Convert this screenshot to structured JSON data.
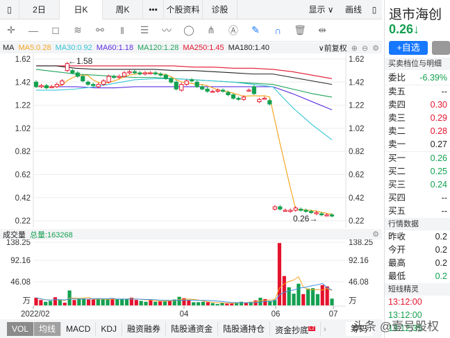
{
  "tabs": [
    "2日",
    "日K",
    "周K",
    "•••",
    "个股资料",
    "诊股"
  ],
  "tab_display": "显示 ∨",
  "tab_draw": "画线",
  "stock": {
    "name": "退市海创",
    "price": "0.26",
    "arrow": "↓",
    "add_btn": "+自选"
  },
  "ma_legend": {
    "ma": "MA",
    "ma5": "MA5:0.28",
    "ma30": "MA30:0.92",
    "ma60": "MA60:1.18",
    "ma120": "MA120:1.28",
    "ma250": "MA250:1.45",
    "ma180": "MA180:1.40",
    "adjust": "∨前复权"
  },
  "colors": {
    "up": "#e5132d",
    "down": "#14a050",
    "ma5": "#f5a623",
    "ma30": "#36c5d6",
    "ma60": "#5b2ee0",
    "ma120": "#1fa35a",
    "ma250": "#e5132d",
    "ma180": "#222222"
  },
  "price_axis": [
    "1.62",
    "1.42",
    "1.22",
    "1.02",
    "0.82",
    "0.62",
    "0.42",
    "0.22"
  ],
  "annot_high": "←1.58",
  "annot_low": "0.26→",
  "volume": {
    "title": "成交量",
    "total": "总量:163268",
    "axis": [
      "138.25",
      "92.16",
      "46.08",
      "万"
    ]
  },
  "dates": [
    "2022/02",
    "04",
    "06",
    "07"
  ],
  "bottom_tabs": [
    "VOL",
    "均线",
    "MACD",
    "KDJ",
    "融资融券",
    "陆股通资金",
    "陆股通持仓",
    "资金抄底"
  ],
  "bottom_badge": "L2",
  "chips": "筹码",
  "chart_data": {
    "type": "candlestick",
    "ylim": [
      0.22,
      1.62
    ],
    "candles": [
      [
        1.42,
        1.38
      ],
      [
        1.38,
        1.39
      ],
      [
        1.39,
        1.37
      ],
      [
        1.38,
        1.38
      ],
      [
        1.38,
        1.4
      ],
      [
        1.4,
        1.43
      ],
      [
        1.52,
        1.58
      ],
      [
        1.52,
        1.5
      ],
      [
        1.5,
        1.47
      ],
      [
        1.47,
        1.43
      ],
      [
        1.42,
        1.4
      ],
      [
        1.4,
        1.39
      ],
      [
        1.38,
        1.4
      ],
      [
        1.4,
        1.43
      ],
      [
        1.42,
        1.47
      ],
      [
        1.47,
        1.46
      ],
      [
        1.46,
        1.47
      ],
      [
        1.47,
        1.5
      ],
      [
        1.5,
        1.51
      ],
      [
        1.51,
        1.5
      ],
      [
        1.5,
        1.49
      ],
      [
        1.49,
        1.5
      ],
      [
        1.5,
        1.5
      ],
      [
        1.5,
        1.49
      ],
      [
        1.49,
        1.48
      ],
      [
        1.48,
        1.45
      ],
      [
        1.45,
        1.42
      ],
      [
        1.42,
        1.36
      ],
      [
        1.35,
        1.4
      ],
      [
        1.4,
        1.43
      ],
      [
        1.44,
        1.43
      ],
      [
        1.42,
        1.38
      ],
      [
        1.38,
        1.36
      ],
      [
        1.36,
        1.34
      ],
      [
        1.34,
        1.34
      ],
      [
        1.34,
        1.35
      ],
      [
        1.35,
        1.34
      ],
      [
        1.33,
        1.31
      ],
      [
        1.31,
        1.28
      ],
      [
        1.28,
        1.27
      ],
      [
        1.27,
        1.29
      ],
      [
        1.35,
        1.35
      ],
      [
        1.38,
        1.32
      ],
      [
        1.25,
        1.27
      ],
      [
        1.28,
        1.28
      ],
      [
        1.26,
        1.23
      ],
      [
        0.32,
        0.34
      ],
      [
        0.34,
        0.32
      ],
      [
        0.31,
        0.31
      ],
      [
        0.3,
        0.31
      ],
      [
        0.31,
        0.33
      ],
      [
        0.32,
        0.31
      ],
      [
        0.31,
        0.3
      ],
      [
        0.3,
        0.29
      ],
      [
        0.28,
        0.29
      ],
      [
        0.28,
        0.27
      ],
      [
        0.27,
        0.27
      ],
      [
        0.27,
        0.26
      ]
    ],
    "volumes": [
      17,
      12,
      8,
      10,
      18,
      12,
      6,
      33,
      12,
      15,
      15,
      13,
      13,
      14,
      13,
      14,
      15,
      14,
      14,
      14,
      17,
      12,
      10,
      8,
      12,
      8,
      9,
      10,
      11,
      13,
      19,
      16,
      11,
      7,
      7,
      8,
      7,
      5,
      3,
      6,
      4,
      5,
      7,
      8,
      6,
      8,
      11,
      17,
      14,
      10,
      12,
      138,
      65,
      40,
      26,
      48,
      25,
      37,
      38,
      25,
      45,
      42,
      15
    ],
    "ma30": [
      1.35,
      1.35,
      1.36,
      1.38,
      1.41,
      1.44,
      1.45,
      1.45,
      1.44,
      1.43,
      1.42,
      1.4,
      1.38,
      1.2,
      1.05,
      0.92
    ],
    "ma60": [
      1.38,
      1.38,
      1.38,
      1.37,
      1.37,
      1.38,
      1.38,
      1.38,
      1.38,
      1.38,
      1.38,
      1.38,
      1.38,
      1.32,
      1.25,
      1.18
    ],
    "ma120": [
      1.53,
      1.51,
      1.49,
      1.48,
      1.47,
      1.46,
      1.46,
      1.45,
      1.44,
      1.43,
      1.42,
      1.41,
      1.4,
      1.36,
      1.32,
      1.29
    ],
    "ma250": [
      1.56,
      1.56,
      1.56,
      1.56,
      1.56,
      1.56,
      1.56,
      1.56,
      1.55,
      1.55,
      1.54,
      1.54,
      1.53,
      1.51,
      1.48,
      1.45
    ],
    "ma180": [
      1.56,
      1.56,
      1.54,
      1.53,
      1.53,
      1.53,
      1.53,
      1.52,
      1.52,
      1.51,
      1.5,
      1.49,
      1.49,
      1.46,
      1.43,
      1.4
    ]
  },
  "panel": {
    "orderbook_title": "买卖档位与明细",
    "weibi_label": "委比",
    "weibi": "-6.39%",
    "asks": [
      {
        "l": "卖五",
        "v": "--",
        "c": ""
      },
      {
        "l": "卖四",
        "v": "0.30",
        "c": "red"
      },
      {
        "l": "卖三",
        "v": "0.29",
        "c": "red"
      },
      {
        "l": "卖二",
        "v": "0.28",
        "c": "red"
      },
      {
        "l": "卖一",
        "v": "0.27",
        "c": ""
      }
    ],
    "bids": [
      {
        "l": "买一",
        "v": "0.26",
        "c": "green"
      },
      {
        "l": "买二",
        "v": "0.25",
        "c": "green"
      },
      {
        "l": "买三",
        "v": "0.24",
        "c": "green"
      },
      {
        "l": "买四",
        "v": "--",
        "c": ""
      },
      {
        "l": "买五",
        "v": "--",
        "c": ""
      }
    ],
    "market_title": "行情数据",
    "market": [
      {
        "l": "昨收",
        "v": "0.2",
        "c": ""
      },
      {
        "l": "今开",
        "v": "0.2",
        "c": ""
      },
      {
        "l": "最高",
        "v": "0.2",
        "c": ""
      },
      {
        "l": "最低",
        "v": "0.2",
        "c": "green"
      }
    ],
    "sprite_title": "短线精灵",
    "sprite": [
      {
        "t": "13:12:00",
        "c": "red"
      },
      {
        "t": "13:12:00",
        "c": "green"
      },
      {
        "t": "13:12:35",
        "c": "green"
      }
    ]
  },
  "watermark": "头条 @壹号股权"
}
